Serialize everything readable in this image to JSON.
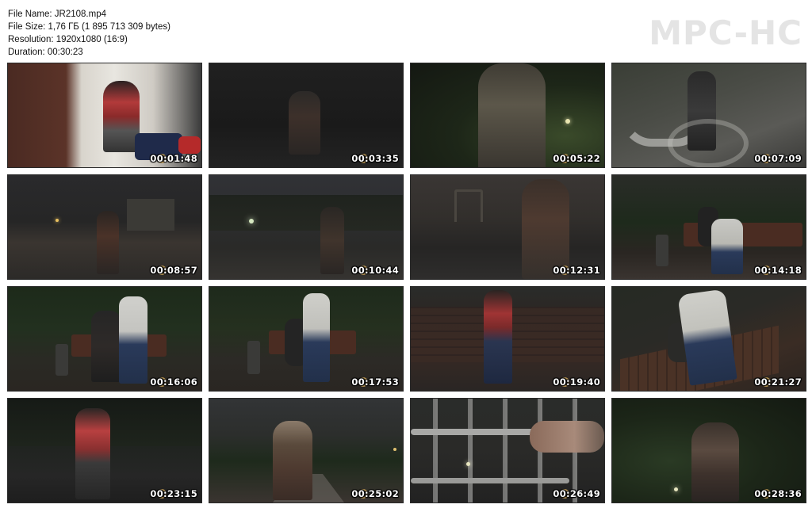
{
  "file_info": {
    "name_line": "File Name: JR2108.mp4",
    "size_line": "File Size: 1,76 ГБ (1 895 713 309 bytes)",
    "resolution_line": "Resolution: 1920x1080 (16:9)",
    "duration_line": "Duration: 00:30:23"
  },
  "logo_text": "MPC-HC",
  "thumbnails": [
    {
      "time": "00:01:48"
    },
    {
      "time": "00:03:35"
    },
    {
      "time": "00:05:22"
    },
    {
      "time": "00:07:09"
    },
    {
      "time": "00:08:57"
    },
    {
      "time": "00:10:44"
    },
    {
      "time": "00:12:31"
    },
    {
      "time": "00:14:18"
    },
    {
      "time": "00:16:06"
    },
    {
      "time": "00:17:53"
    },
    {
      "time": "00:19:40"
    },
    {
      "time": "00:21:27"
    },
    {
      "time": "00:23:15"
    },
    {
      "time": "00:25:02"
    },
    {
      "time": "00:26:49"
    },
    {
      "time": "00:28:36"
    }
  ],
  "colors": {
    "logo": "#e4e4e4",
    "timestamp": "#ffffff",
    "timestamp_icon": "#c9a35a"
  }
}
